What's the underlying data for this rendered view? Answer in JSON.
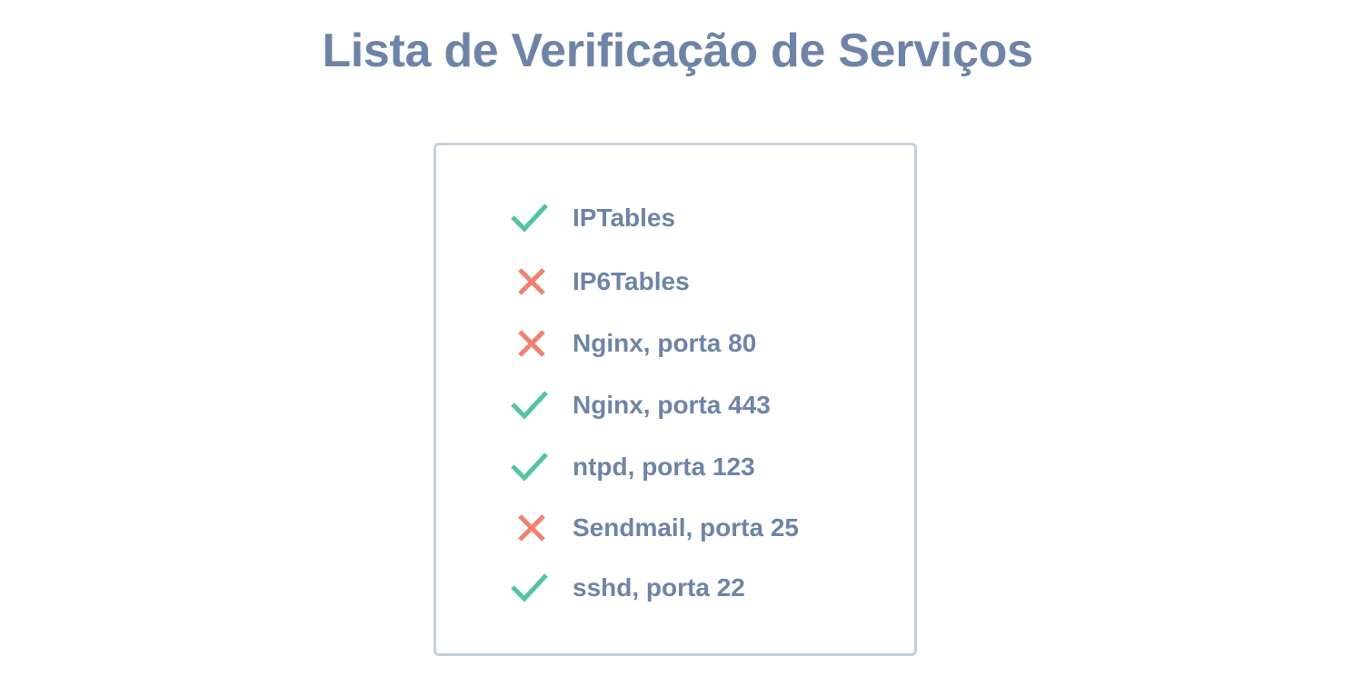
{
  "title": "Lista de Verificação de Serviços",
  "colors": {
    "text": "#6d84a8",
    "border": "#c5cede",
    "ok": "#4fc79a",
    "fail": "#f37f6c"
  },
  "services": [
    {
      "label": "IPTables",
      "status": "ok",
      "icon": "check-icon"
    },
    {
      "label": "IP6Tables",
      "status": "fail",
      "icon": "cross-icon"
    },
    {
      "label": "Nginx, porta 80",
      "status": "fail",
      "icon": "cross-icon"
    },
    {
      "label": "Nginx, porta 443",
      "status": "ok",
      "icon": "check-icon"
    },
    {
      "label": "ntpd, porta 123",
      "status": "ok",
      "icon": "check-icon"
    },
    {
      "label": "Sendmail, porta 25",
      "status": "fail",
      "icon": "cross-icon"
    },
    {
      "label": "sshd, porta 22",
      "status": "ok",
      "icon": "check-icon"
    }
  ]
}
